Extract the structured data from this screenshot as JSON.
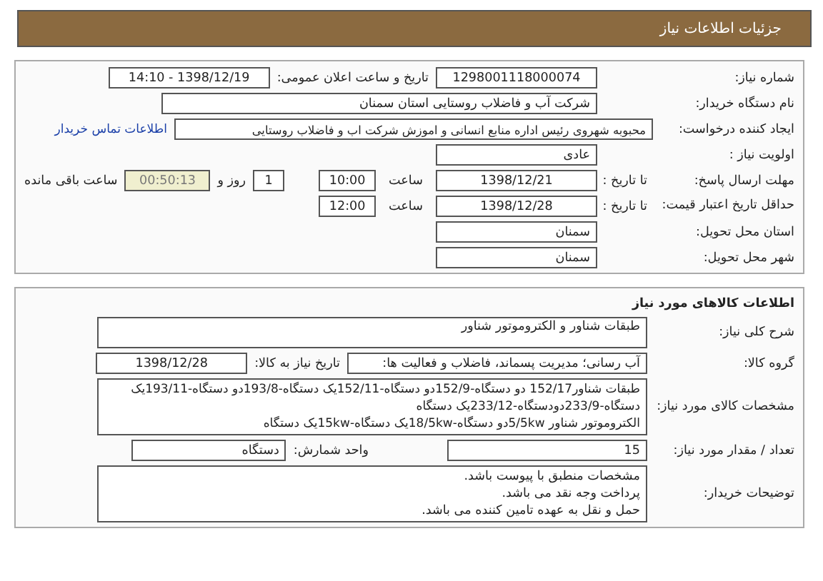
{
  "header": {
    "title": "جزئیات اطلاعات نیاز"
  },
  "need_details": {
    "need_number": {
      "label": "شماره نیاز:",
      "value": "1298001118000074"
    },
    "announce_datetime": {
      "label": "تاریخ و ساعت اعلان عمومی:",
      "value": "1398/12/19 - 14:10"
    },
    "buyer_org": {
      "label": "نام دستگاه خریدار:",
      "value": "شرکت آب و فاضلاب روستایی استان سمنان"
    },
    "requester": {
      "label": "ایجاد کننده درخواست:",
      "value": "محبوبه شهروی رئیس اداره منابع انسانی و اموزش شرکت اب و فاضلاب روستایی",
      "link": "اطلاعات تماس خریدار"
    },
    "priority": {
      "label": "اولویت نیاز :",
      "value": "عادی"
    },
    "response_deadline": {
      "label": "مهلت ارسال پاسخ:",
      "date_label": "تا تاریخ :",
      "date": "1398/12/21",
      "time_label": "ساعت",
      "time": "10:00",
      "days": "1",
      "days_label": "روز و",
      "remaining": "00:50:13",
      "remaining_label": "ساعت باقی مانده"
    },
    "price_validity": {
      "label": "حداقل تاریخ اعتبار قیمت:",
      "date_label": "تا تاریخ :",
      "date": "1398/12/28",
      "time_label": "ساعت",
      "time": "12:00"
    },
    "delivery_province": {
      "label": "استان محل تحویل:",
      "value": "سمنان"
    },
    "delivery_city": {
      "label": "شهر محل تحویل:",
      "value": "سمنان"
    }
  },
  "goods": {
    "title": "اطلاعات کالاهای مورد نیاز",
    "description": {
      "label": "شرح کلی نیاز:",
      "value": "طبقات شناور و الکتروموتور شناور"
    },
    "group": {
      "label": "گروه کالا:",
      "value": "آب رسانی؛ مدیریت پسماند، فاضلاب و فعالیت ها:"
    },
    "need_date": {
      "label": "تاریخ نیاز به کالا:",
      "value": "1398/12/28"
    },
    "specs": {
      "label": "مشخصات کالای مورد نیاز:",
      "lines": [
        "طبقات شناور152/17 دو دستگاه-152/9دو دستگاه-152/11یک دستگاه-193/8دو دستگاه-193/11یک",
        "دستگاه-233/9دودستگاه-233/12یک دستگاه",
        "الکتروموتور شناور 5/5kwدو دستگاه-18/5kwیک دستگاه-15kwیک دستگاه"
      ]
    },
    "quantity": {
      "label": "تعداد / مقدار مورد نیاز:",
      "value": "15"
    },
    "unit": {
      "label": "واحد شمارش:",
      "value": "دستگاه"
    },
    "buyer_notes": {
      "label": "توضیحات خریدار:",
      "lines": [
        "مشخصات منطبق با پیوست باشد.",
        "پرداخت وجه نقد می باشد.",
        "حمل و نقل به عهده تامین کننده می باشد."
      ]
    }
  }
}
